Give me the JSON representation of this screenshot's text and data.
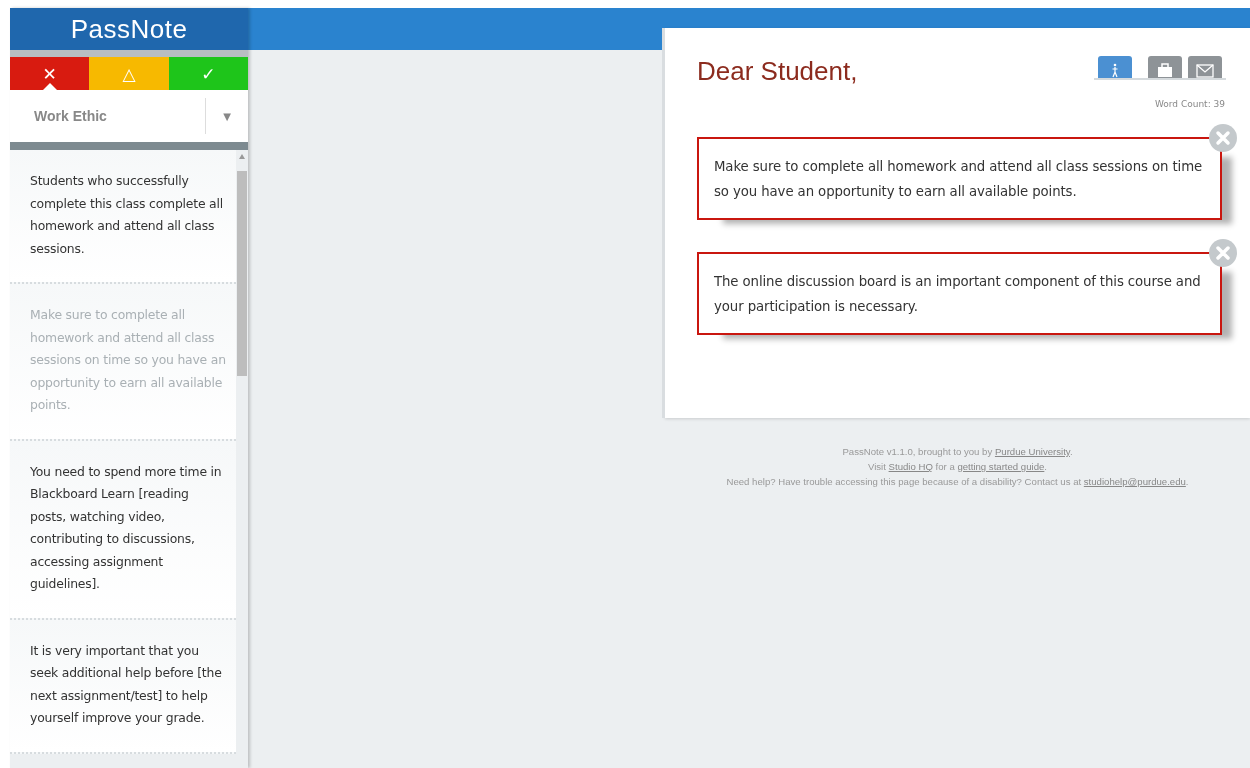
{
  "app": {
    "logo": "PassNote"
  },
  "rating_tabs": [
    {
      "kind": "poor",
      "label": "✕",
      "selected": true
    },
    {
      "kind": "warn",
      "label": "△",
      "selected": false
    },
    {
      "kind": "good",
      "label": "✓",
      "selected": false
    }
  ],
  "category": {
    "value": "Work Ethic",
    "arrow": "▼"
  },
  "comments": [
    {
      "text": "Students who successfully complete this class complete all homework and attend all class sessions.",
      "used": false
    },
    {
      "text": "Make sure to complete all homework and attend all class sessions on time so you have an opportunity to earn all available points.",
      "used": true
    },
    {
      "text": "You need to spend more time in Blackboard Learn [reading posts, watching video, contributing to discussions, accessing assignment guidelines].",
      "used": false
    },
    {
      "text": "It is very important that you seek additional help before [the next assignment/test] to help yourself improve your grade.",
      "used": false
    }
  ],
  "letter": {
    "greeting": "Dear Student,",
    "word_count": "Word Count: 39",
    "tools": [
      {
        "kind": "person",
        "selected": true
      },
      {
        "kind": "briefcase",
        "selected": false
      },
      {
        "kind": "mail",
        "selected": false
      }
    ],
    "paragraphs": [
      "Make sure to complete all homework and attend all class sessions on time so you have an opportunity to earn all available points.",
      "The online discussion board is an important component of this course and your participation is necessary."
    ]
  },
  "footer": [
    [
      {
        "text": "PassNote v1.1.0, brought to you by "
      },
      {
        "text": "Purdue University",
        "link": true
      },
      {
        "text": "."
      }
    ],
    [
      {
        "text": "Visit "
      },
      {
        "text": "Studio HQ",
        "link": true
      },
      {
        "text": " for a "
      },
      {
        "text": "getting started guide",
        "link": true
      },
      {
        "text": "."
      }
    ],
    [
      {
        "text": "Need help? Have trouble accessing this page because of a disability? Contact us at "
      },
      {
        "text": "studiohelp@purdue.edu",
        "link": true
      },
      {
        "text": "."
      }
    ]
  ]
}
